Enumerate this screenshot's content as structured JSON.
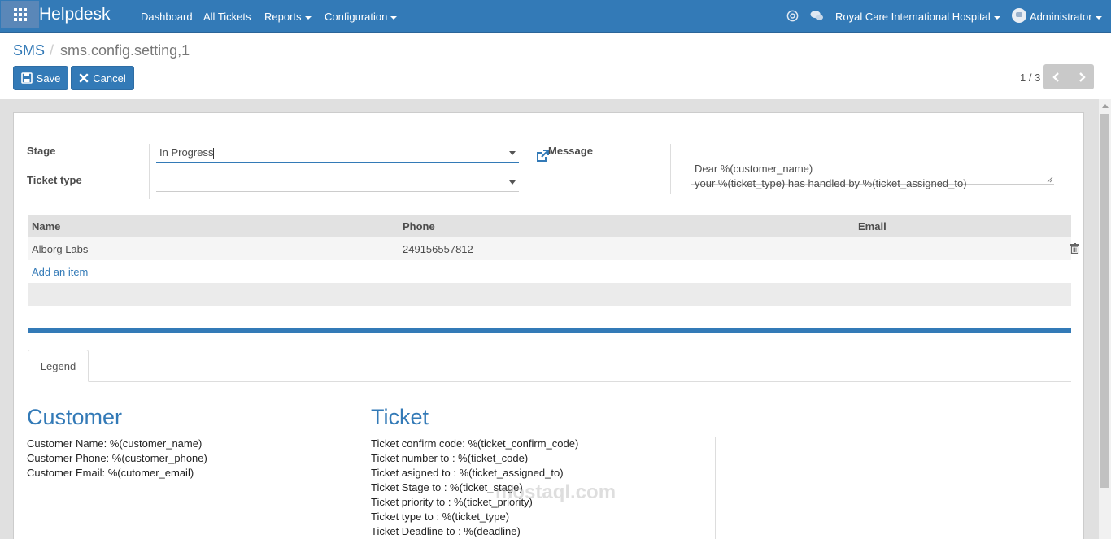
{
  "navbar": {
    "brand": "Helpdesk",
    "menu": [
      "Dashboard",
      "All Tickets",
      "Reports",
      "Configuration"
    ],
    "company": "Royal Care International Hospital",
    "user": "Administrator"
  },
  "breadcrumb": {
    "parent": "SMS",
    "separator": "/",
    "current": "sms.config.setting,1"
  },
  "buttons": {
    "save": "Save",
    "cancel": "Cancel"
  },
  "pager": {
    "value": "1 / 3"
  },
  "form": {
    "stage_label": "Stage",
    "stage_value": "In Progress",
    "ticket_type_label": "Ticket type",
    "ticket_type_value": "",
    "message_label": "Message",
    "message_value": "Dear %(customer_name)\nyour %(ticket_type)  has handled by %(ticket_assigned_to)"
  },
  "table": {
    "columns": [
      "Name",
      "Phone",
      "Email"
    ],
    "rows": [
      {
        "name": "Alborg Labs",
        "phone": "249156557812",
        "email": ""
      }
    ],
    "add_item": "Add an item"
  },
  "notebook": {
    "tab": "Legend"
  },
  "legend": {
    "customer_title": "Customer",
    "customer_lines": [
      "Customer Name: %(customer_name)",
      "Customer Phone: %(customer_phone)",
      "Customer Email: %(cutomer_email)"
    ],
    "ticket_title": "Ticket",
    "ticket_lines": [
      "Ticket confirm code: %(ticket_confirm_code)",
      "Ticket number to : %(ticket_code)",
      "Ticket asigned to : %(ticket_assigned_to)",
      "Ticket Stage to : %(ticket_stage)",
      "Ticket priority to : %(ticket_priority)",
      "Ticket type to : %(ticket_type)",
      "Ticket Deadline to : %(deadline)"
    ]
  },
  "watermark": "mostaql.com",
  "colors": {
    "primary": "#337ab7",
    "navbar": "#337ab7"
  }
}
